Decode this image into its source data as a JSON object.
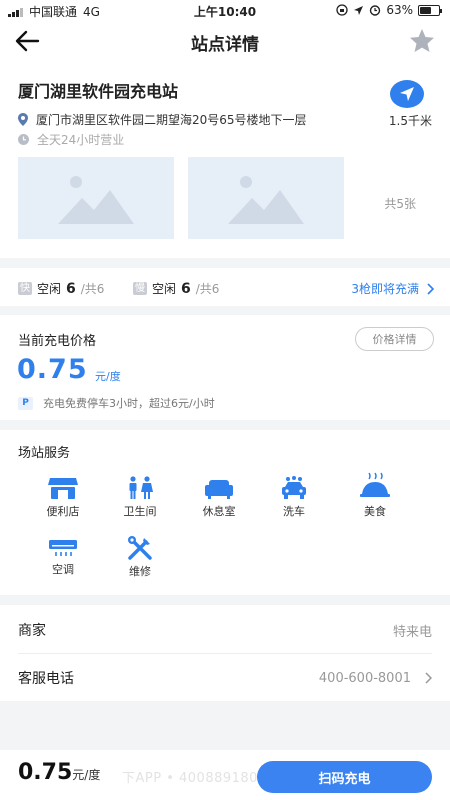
{
  "status_bar": {
    "carrier": "中国联通",
    "network": "4G",
    "time": "上午10:40",
    "battery_text": "63%",
    "battery_level": 0.63
  },
  "nav": {
    "title": "站点详情",
    "back_icon": "back-arrow-icon",
    "favorite_icon": "star-icon"
  },
  "station": {
    "name": "厦门湖里软件园充电站",
    "address": "厦门市湖里区软件园二期望海20号65号楼地下一层",
    "hours": "全天24小时营业",
    "distance": "1.5千米",
    "photo_count": "共5张"
  },
  "slots": {
    "fast_tag": "快",
    "fast_label": "空闲",
    "fast_free": "6",
    "fast_total": "/共6",
    "slow_tag": "慢",
    "slow_label": "空闲",
    "slow_free": "6",
    "slow_total": "/共6",
    "link_text": "3枪即将充满"
  },
  "price": {
    "title": "当前充电价格",
    "detail_button": "价格详情",
    "value": "0.75",
    "unit": "元/度",
    "parking_badge": "P",
    "parking_note": "充电免费停车3小时，超过6元/小时"
  },
  "services": {
    "title": "场站服务",
    "items": [
      {
        "label": "便利店",
        "icon": "store-icon"
      },
      {
        "label": "卫生间",
        "icon": "restroom-icon"
      },
      {
        "label": "休息室",
        "icon": "sofa-icon"
      },
      {
        "label": "洗车",
        "icon": "car-wash-icon"
      },
      {
        "label": "美食",
        "icon": "food-icon"
      },
      {
        "label": "空调",
        "icon": "air-conditioner-icon"
      },
      {
        "label": "维修",
        "icon": "repair-tools-icon"
      }
    ]
  },
  "info": {
    "merchant_label": "商家",
    "merchant_value": "特来电",
    "phone_label": "客服电话",
    "phone_value": "400-600-8001"
  },
  "bottom": {
    "price": "0.75",
    "unit": "元/度",
    "watermark": "下APP • 4008891800.COM",
    "scan_button": "扫码充电"
  },
  "colors": {
    "accent": "#2f80ed",
    "button": "#3a83f1",
    "background": "#f3f4f6"
  }
}
